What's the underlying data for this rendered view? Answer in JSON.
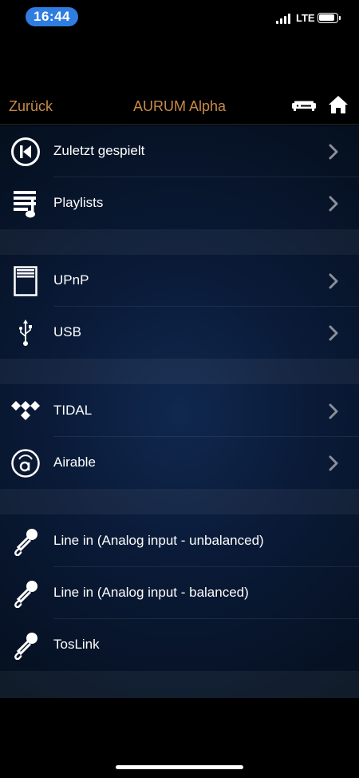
{
  "status_bar": {
    "time": "16:44",
    "network": "LTE"
  },
  "nav": {
    "back_label": "Zurück",
    "title": "AURUM Alpha"
  },
  "colors": {
    "accent": "#c88a48",
    "time_pill": "#2f7de1",
    "background_blue": "#0a1a37"
  },
  "sections": [
    {
      "rows": [
        {
          "label": "Zuletzt gespielt",
          "icon": "rewind-icon",
          "chevron": true
        },
        {
          "label": "Playlists",
          "icon": "playlist-icon",
          "chevron": true
        }
      ]
    },
    {
      "rows": [
        {
          "label": "UPnP",
          "icon": "server-icon",
          "chevron": true
        },
        {
          "label": "USB",
          "icon": "usb-icon",
          "chevron": true
        }
      ]
    },
    {
      "rows": [
        {
          "label": "TIDAL",
          "icon": "tidal-icon",
          "chevron": true
        },
        {
          "label": "Airable",
          "icon": "airable-icon",
          "chevron": true
        }
      ]
    },
    {
      "rows": [
        {
          "label": "Line in (Analog input - unbalanced)",
          "icon": "microphone-icon",
          "chevron": false
        },
        {
          "label": "Line in (Analog input - balanced)",
          "icon": "microphone-icon",
          "chevron": false
        },
        {
          "label": "TosLink",
          "icon": "microphone-icon",
          "chevron": false
        }
      ]
    }
  ]
}
